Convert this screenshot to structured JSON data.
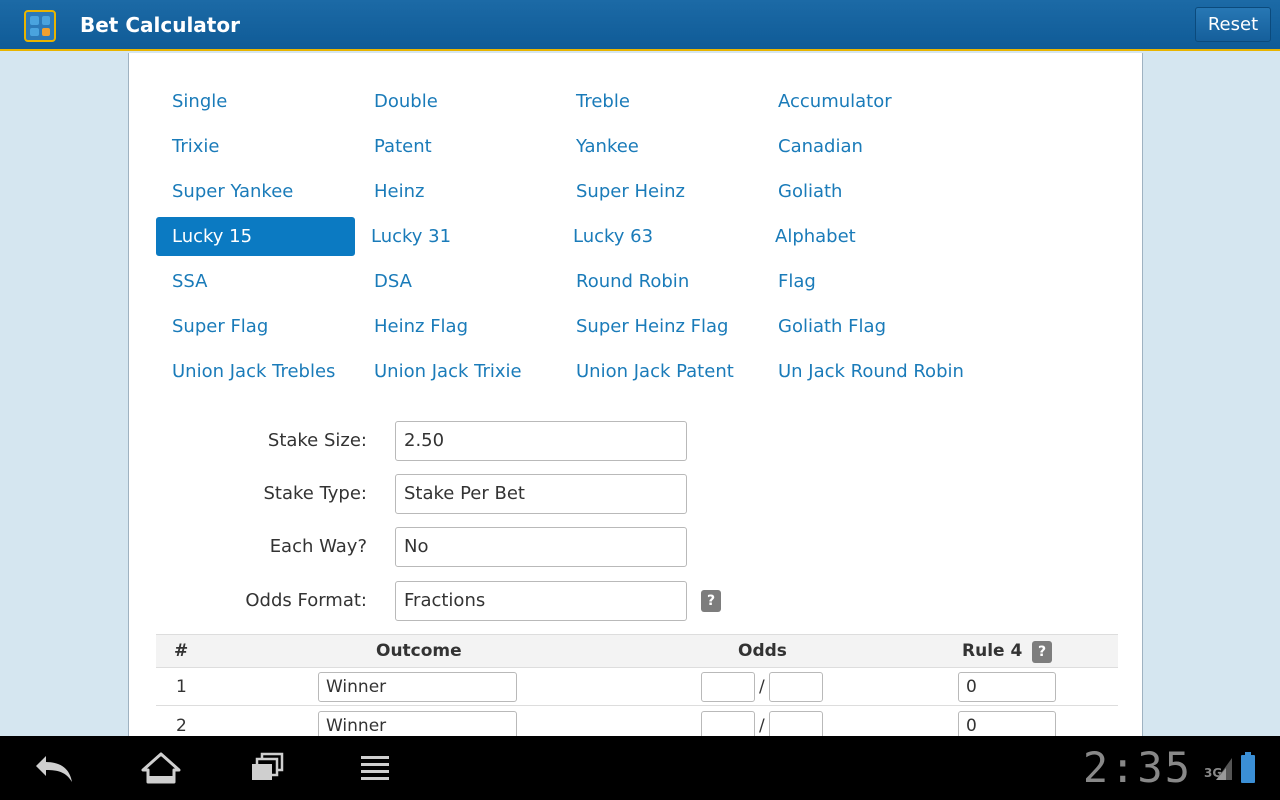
{
  "app": {
    "title": "Bet Calculator",
    "reset_label": "Reset",
    "colors": {
      "accent": "#1a7bb9",
      "selected": "#0b7ac2",
      "bar": "#0f5b97",
      "gold": "#e8b400"
    }
  },
  "bet_types": [
    [
      "Single",
      "Double",
      "Treble",
      "Accumulator"
    ],
    [
      "Trixie",
      "Patent",
      "Yankee",
      "Canadian"
    ],
    [
      "Super Yankee",
      "Heinz",
      "Super Heinz",
      "Goliath"
    ],
    [
      "Lucky 15",
      "Lucky 31",
      "Lucky 63",
      "Alphabet"
    ],
    [
      "SSA",
      "DSA",
      "Round Robin",
      "Flag"
    ],
    [
      "Super Flag",
      "Heinz Flag",
      "Super Heinz Flag",
      "Goliath Flag"
    ],
    [
      "Union Jack Trebles",
      "Union Jack Trixie",
      "Union Jack Patent",
      "Un Jack Round Robin"
    ]
  ],
  "selected_bet": "Lucky 15",
  "form": {
    "stake_size": {
      "label": "Stake Size:",
      "value": "2.50"
    },
    "stake_type": {
      "label": "Stake Type:",
      "value": "Stake Per Bet"
    },
    "each_way": {
      "label": "Each Way?",
      "value": "No"
    },
    "odds_format": {
      "label": "Odds Format:",
      "value": "Fractions"
    },
    "help_label": "?"
  },
  "table": {
    "headers": {
      "num": "#",
      "outcome": "Outcome",
      "odds": "Odds",
      "rule4": "Rule 4"
    },
    "rows": [
      {
        "num": "1",
        "outcome": "Winner",
        "odds_num": "",
        "odds_den": "",
        "rule4": "0"
      },
      {
        "num": "2",
        "outcome": "Winner",
        "odds_num": "",
        "odds_den": "",
        "rule4": "0"
      }
    ],
    "odds_separator": "/"
  },
  "system": {
    "clock": "2:35",
    "network": "3G",
    "icons": [
      "back-icon",
      "home-icon",
      "recent-apps-icon",
      "menu-icon"
    ]
  }
}
